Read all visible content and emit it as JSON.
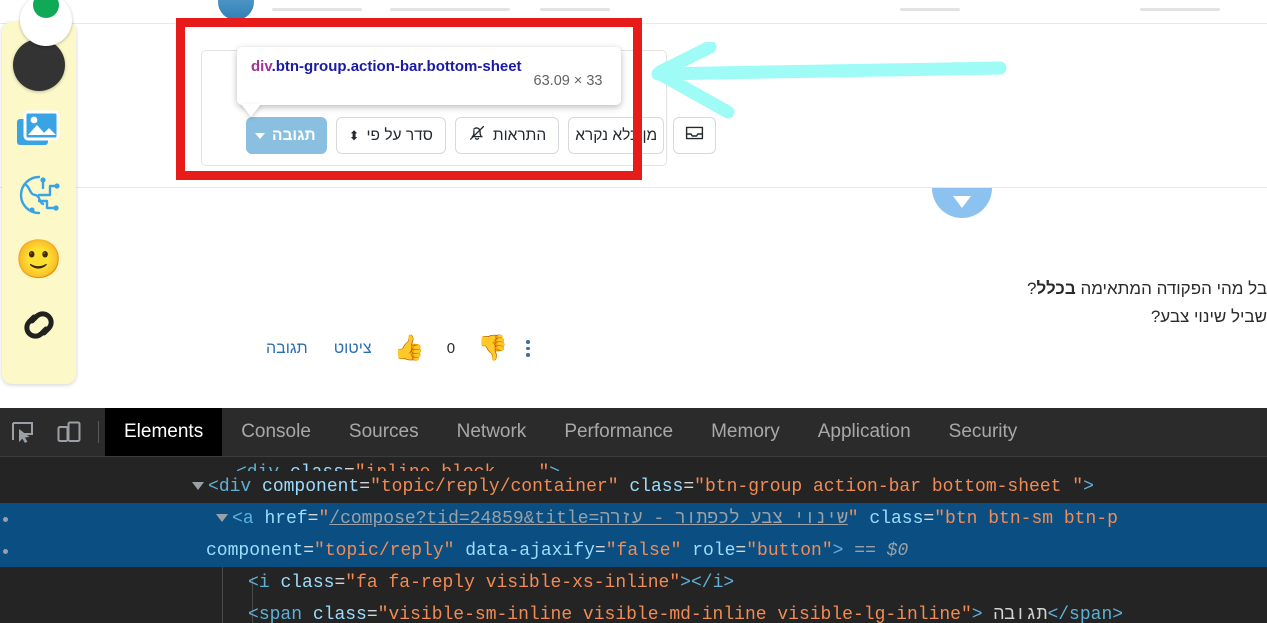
{
  "page": {
    "side_toolbar": {
      "items": [
        {
          "name": "green-status-icon",
          "glyph": ""
        },
        {
          "name": "black-circle-icon",
          "glyph": ""
        },
        {
          "name": "image-gallery-icon",
          "glyph": "🖼"
        },
        {
          "name": "network-tech-icon",
          "glyph": "🕸"
        },
        {
          "name": "smiley-face-icon",
          "glyph": "🙂"
        },
        {
          "name": "link-chain-icon",
          "glyph": "🔗"
        }
      ]
    },
    "devtools_tooltip": {
      "tag": "div",
      "classes": ".btn-group.action-bar.bottom-sheet",
      "dimensions": "63.09 × 33"
    },
    "action_bar": {
      "reply_label": "תגובה",
      "sort_label": "סדר על פי",
      "notifications_label": "התראות",
      "mark_unread_label": "מן כלא נקרא",
      "inbox_icon": "inbox-icon"
    },
    "post_body": {
      "line1_prefix": "בל מהי הפקודה המתאימה ",
      "line1_bold": "בכלל",
      "line1_suffix": "?",
      "line2": "שביל שינוי צבע?"
    },
    "post_footer": {
      "reply_link": "תגובה",
      "quote_link": "ציטוט",
      "thumbs_up": "👍",
      "vote_count": "0",
      "thumbs_down": "👎",
      "more_menu": "kebab-menu-icon"
    },
    "collapse_handle": "chevron-down-icon",
    "annotation": {
      "red_box_color": "#e81b1b",
      "arrow_color": "#9ffbf6"
    }
  },
  "devtools": {
    "toolbar": {
      "inspect_icon": "inspect-element-icon",
      "device_icon": "device-toolbar-icon"
    },
    "tabs": [
      {
        "label": "Elements",
        "active": true
      },
      {
        "label": "Console",
        "active": false
      },
      {
        "label": "Sources",
        "active": false
      },
      {
        "label": "Network",
        "active": false
      },
      {
        "label": "Performance",
        "active": false
      },
      {
        "label": "Memory",
        "active": false
      },
      {
        "label": "Application",
        "active": false
      },
      {
        "label": "Security",
        "active": false
      }
    ],
    "code": {
      "line_div_tag": "div",
      "line_div_attr1_name": "component",
      "line_div_attr1_value": "topic/reply/container",
      "line_div_attr2_name": "class",
      "line_div_attr2_value": "btn-group action-bar bottom-sheet ",
      "line_a_tag": "a",
      "line_a_href_name": "href",
      "line_a_href_value": "/compose?tid=24859&title=שינוי צבע לכפתור - עזרה",
      "line_a_class_name": "class",
      "line_a_class_value": "btn btn-sm btn-p",
      "line_a_attr3_name": "component",
      "line_a_attr3_value": "topic/reply",
      "line_a_attr4_name": "data-ajaxify",
      "line_a_attr4_value": "false",
      "line_a_attr5_name": "role",
      "line_a_attr5_value": "button",
      "selected_marker": "== $0",
      "line_i_tag": "i",
      "line_i_class_name": "class",
      "line_i_class_value": "fa fa-reply visible-xs-inline",
      "line_i_close": "</i>",
      "line_span_tag": "span",
      "line_span_class_name": "class",
      "line_span_class_value": "visible-sm-inline visible-md-inline visible-lg-inline",
      "line_span_text": "תגובה",
      "line_span_close": "</span>"
    }
  }
}
